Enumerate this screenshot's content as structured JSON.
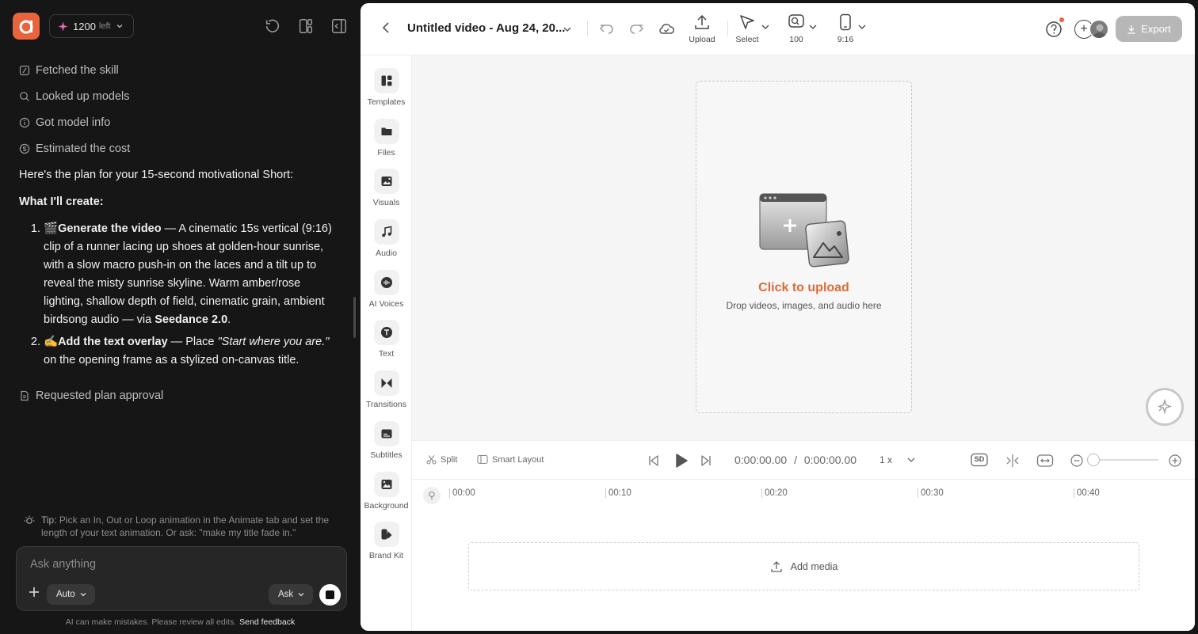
{
  "chat": {
    "credits": {
      "count": "1200",
      "suffix": "left"
    },
    "steps": [
      {
        "label": "Fetched the skill"
      },
      {
        "label": "Looked up models"
      },
      {
        "label": "Got model info"
      },
      {
        "label": "Estimated the cost"
      }
    ],
    "message": {
      "intro": "Here's the plan for your 15-second motivational Short:",
      "heading": "What I'll create:",
      "item1": {
        "emoji": "🎬",
        "title": "Generate the video",
        "text": " — A cinematic 15s vertical (9:16) clip of a runner lacing up shoes at golden-hour sunrise, with a slow macro push-in on the laces and a tilt up to reveal the misty sunrise skyline. Warm amber/rose lighting, shallow depth of field, cinematic grain, ambient birdsong audio — via ",
        "model": "Seedance 2.0",
        "end": "."
      },
      "item2": {
        "emoji": "✍️",
        "title": "Add the text overlay",
        "text": " — Place ",
        "quote": "\"Start where you are.\"",
        "end": " on the opening frame as a stylized on-canvas title."
      }
    },
    "request_status": "Requested plan approval",
    "tip": {
      "label": "Tip:",
      "text": " Pick an In, Out or Loop animation in the Animate tab and set the length of your text animation. Or ask: \"make my title fade in.\""
    },
    "composer": {
      "placeholder": "Ask anything",
      "mode_left": "Auto",
      "mode_right": "Ask"
    },
    "footnote": {
      "text": "AI can make mistakes. Please review all edits.",
      "link": "Send feedback"
    }
  },
  "editor": {
    "title": "Untitled video - Aug 24, 20...",
    "toolbar": {
      "upload": "Upload",
      "select": "Select",
      "zoom": "100",
      "aspect": "9:16",
      "export": "Export"
    },
    "rail": [
      {
        "label": "Templates",
        "icon": "templates-icon"
      },
      {
        "label": "Files",
        "icon": "folder-icon"
      },
      {
        "label": "Visuals",
        "icon": "visuals-icon"
      },
      {
        "label": "Audio",
        "icon": "music-note-icon"
      },
      {
        "label": "AI Voices",
        "icon": "voice-wave-icon"
      },
      {
        "label": "Text",
        "icon": "text-icon"
      },
      {
        "label": "Transitions",
        "icon": "transitions-icon"
      },
      {
        "label": "Subtitles",
        "icon": "subtitles-icon"
      },
      {
        "label": "Background",
        "icon": "image-icon"
      },
      {
        "label": "Brand Kit",
        "icon": "brand-kit-icon"
      }
    ],
    "canvas": {
      "cta": "Click to upload",
      "sub": "Drop videos, images, and audio here"
    },
    "controls": {
      "split": "Split",
      "smart_layout": "Smart Layout",
      "current_time": "0:00:00.00",
      "separator": "/",
      "total_time": "0:00:00.00",
      "speed": "1 x",
      "quality": "SD"
    },
    "timeline": {
      "ticks": [
        "00:00",
        "00:10",
        "00:20",
        "00:30",
        "00:40"
      ],
      "add_media": "Add media"
    }
  },
  "colors": {
    "accent": "#e06a35",
    "brand": "#e8643a",
    "chat_bg": "#161616",
    "editor_bg": "#ffffff"
  }
}
